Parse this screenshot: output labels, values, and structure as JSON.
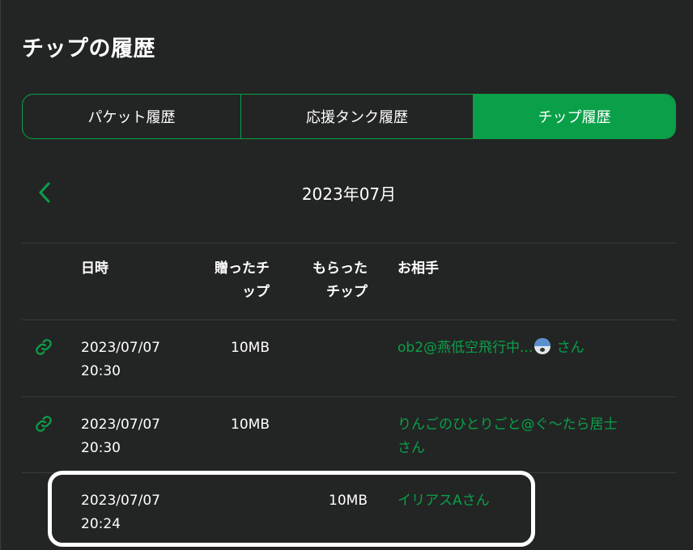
{
  "page": {
    "title": "チップの履歴"
  },
  "tabs": [
    {
      "label": "パケット履歴",
      "active": false
    },
    {
      "label": "応援タンク履歴",
      "active": false
    },
    {
      "label": "チップ履歴",
      "active": true
    }
  ],
  "month": {
    "label": "2023年07月",
    "prev_icon": "chevron-left-icon"
  },
  "table": {
    "headers": {
      "date": "日時",
      "sent_line1": "贈ったチ",
      "sent_line2": "ップ",
      "received_line1": "もらった",
      "received_line2": "チップ",
      "partner": "お相手"
    },
    "rows": [
      {
        "has_link": true,
        "date": "2023/07/07",
        "time": "20:30",
        "sent": "10MB",
        "received": "",
        "partner_name": "ob2@燕低空飛行中...",
        "partner_emoji": "anxious-face-emoji",
        "partner_suffix": "さん"
      },
      {
        "has_link": true,
        "date": "2023/07/07",
        "time": "20:30",
        "sent": "10MB",
        "received": "",
        "partner_name": "りんごのひとりごと@ぐ〜たら居士",
        "partner_suffix": "さん"
      },
      {
        "has_link": false,
        "date": "2023/07/07",
        "time": "20:24",
        "sent": "",
        "received": "10MB",
        "partner_name": "イリアスAさん",
        "partner_suffix": ""
      }
    ]
  },
  "colors": {
    "accent": "#0aa049",
    "background": "#232524",
    "divider": "#3a3c3b"
  }
}
